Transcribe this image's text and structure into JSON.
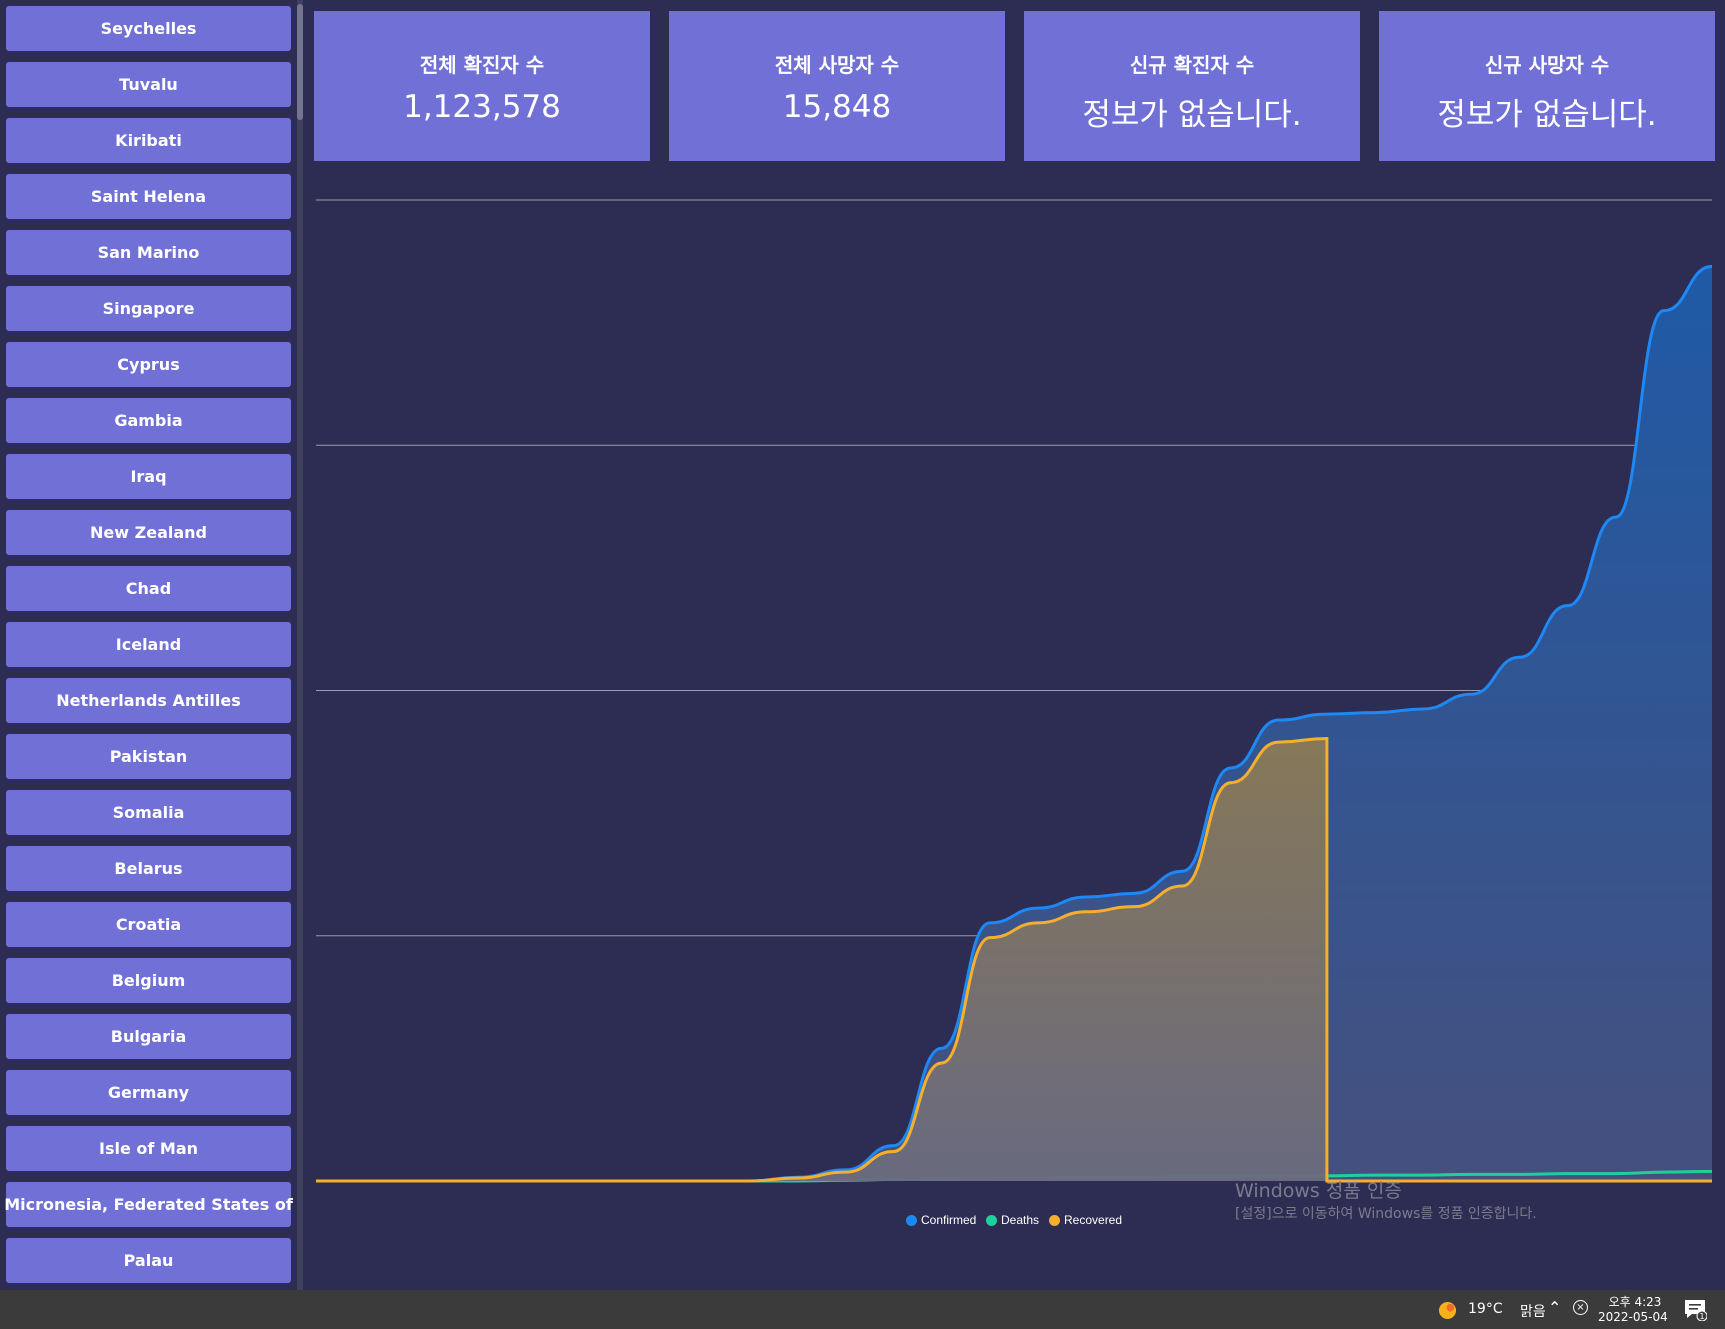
{
  "sidebar": {
    "countries": [
      "Seychelles",
      "Tuvalu",
      "Kiribati",
      "Saint Helena",
      "San Marino",
      "Singapore",
      "Cyprus",
      "Gambia",
      "Iraq",
      "New Zealand",
      "Chad",
      "Iceland",
      "Netherlands Antilles",
      "Pakistan",
      "Somalia",
      "Belarus",
      "Croatia",
      "Belgium",
      "Bulgaria",
      "Germany",
      "Isle of Man",
      "Micronesia, Federated States of",
      "Palau"
    ]
  },
  "stats": {
    "total_confirmed": {
      "title": "전체 확진자 수",
      "value": "1,123,578"
    },
    "total_deaths": {
      "title": "전체 사망자 수",
      "value": "15,848"
    },
    "new_confirmed": {
      "title": "신규 확진자 수",
      "value": "정보가 없습니다."
    },
    "new_deaths": {
      "title": "신규 사망자 수",
      "value": "정보가 없습니다."
    }
  },
  "chart_data": {
    "type": "area",
    "grid": "horizontal",
    "legend_position": "bottom-center",
    "series": [
      {
        "name": "Confirmed",
        "color": "#1e88f5",
        "values": [
          0,
          0,
          0,
          0,
          0,
          0,
          0,
          0,
          0,
          0,
          5,
          15,
          48,
          180,
          350,
          370,
          385,
          390,
          420,
          560,
          625,
          633,
          635,
          640,
          660,
          710,
          780,
          900,
          1180,
          1240
        ]
      },
      {
        "name": "Deaths",
        "color": "#1ed19c",
        "values": [
          0,
          0,
          0,
          0,
          0,
          0,
          0,
          0,
          0,
          0,
          0,
          1,
          2,
          3,
          4,
          4,
          5,
          5,
          6,
          6,
          7,
          7,
          8,
          8,
          9,
          9,
          10,
          10,
          12,
          13
        ]
      },
      {
        "name": "Recovered",
        "color": "#f6ae2d",
        "values": [
          0,
          0,
          0,
          0,
          0,
          0,
          0,
          0,
          0,
          0,
          4,
          12,
          40,
          160,
          330,
          350,
          365,
          372,
          400,
          540,
          595,
          600,
          0,
          0,
          0,
          0,
          0,
          0,
          0,
          0
        ]
      }
    ],
    "ylim": [
      0,
      1330
    ]
  },
  "watermark": {
    "title": "Windows 정품 인증",
    "subtitle": "[설정]으로 이동하여 Windows를 정품 인증합니다."
  },
  "taskbar": {
    "weather_temp": "19°C",
    "weather_condition": "맑음",
    "time": "오후 4:23",
    "date": "2022-05-04",
    "notification_count": "1"
  }
}
